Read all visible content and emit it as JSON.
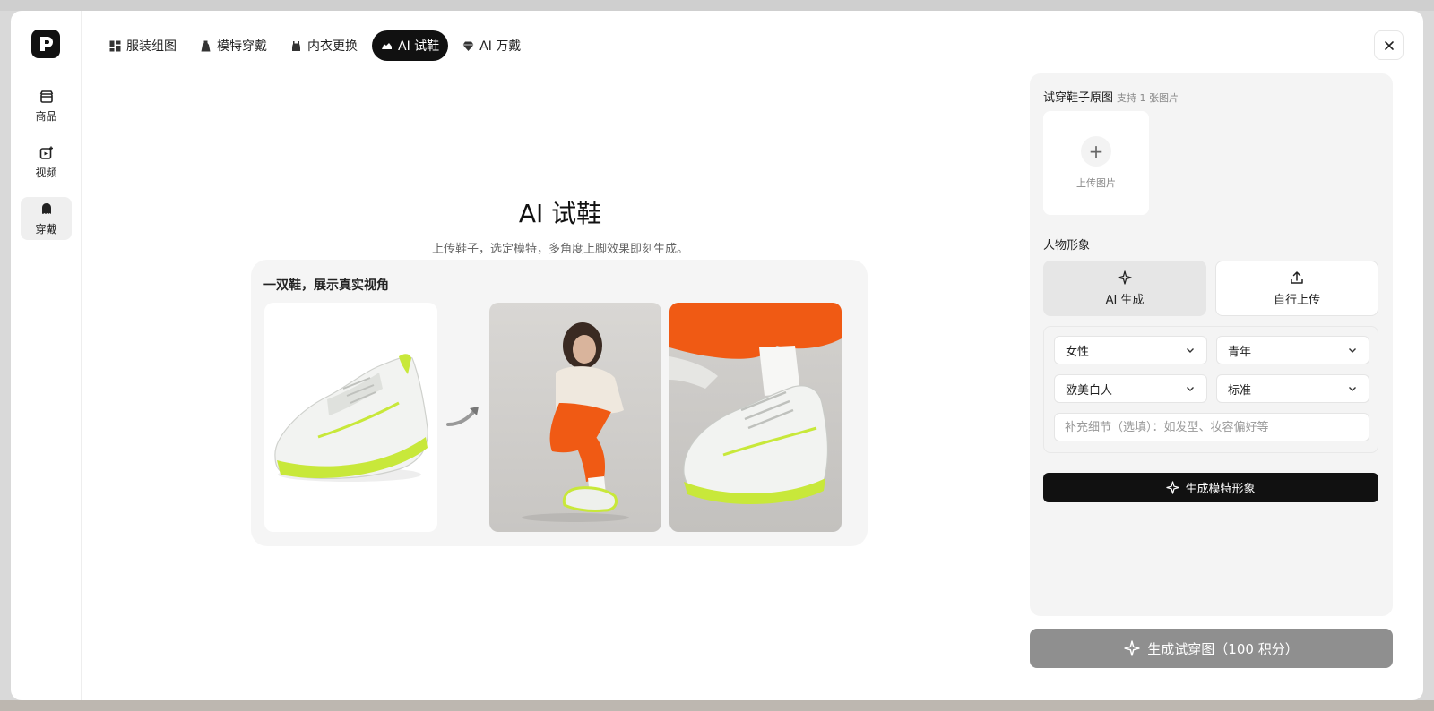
{
  "sidebar": {
    "logo_alt": "P",
    "items": [
      {
        "label": "商品",
        "icon": "store-icon"
      },
      {
        "label": "视频",
        "icon": "video-add-icon"
      },
      {
        "label": "穿戴",
        "icon": "wear-icon",
        "active": true
      }
    ]
  },
  "tabs": [
    {
      "label": "服装组图",
      "icon": "grid-icon"
    },
    {
      "label": "模特穿戴",
      "icon": "dress-icon"
    },
    {
      "label": "内衣更换",
      "icon": "underwear-icon"
    },
    {
      "label": "AI 试鞋",
      "icon": "shoe-icon",
      "active": true
    },
    {
      "label": "AI 万戴",
      "icon": "gem-icon"
    }
  ],
  "hero": {
    "title": "AI 试鞋",
    "subtitle": "上传鞋子，选定模特，多角度上脚效果即刻生成。"
  },
  "example": {
    "title": "一双鞋，展示真实视角"
  },
  "panel": {
    "upload_section_title": "试穿鞋子原图",
    "upload_section_hint": "支持 1 张图片",
    "upload_label": "上传图片",
    "persona_title": "人物形象",
    "mode_ai": "AI 生成",
    "mode_upload": "自行上传",
    "selects": {
      "gender": "女性",
      "age": "青年",
      "ethnicity": "欧美白人",
      "body": "标准"
    },
    "detail_placeholder": "补充细节（选填）：如发型、妆容偏好等",
    "generate_model_label": "生成模特形象"
  },
  "footer": {
    "generate_label": "生成试穿图（100 积分）"
  },
  "colors": {
    "accent": "#111111",
    "shoe_accent": "#c8e83a",
    "pants_orange": "#f05a14",
    "disabled_button": "#8f8f8f"
  }
}
